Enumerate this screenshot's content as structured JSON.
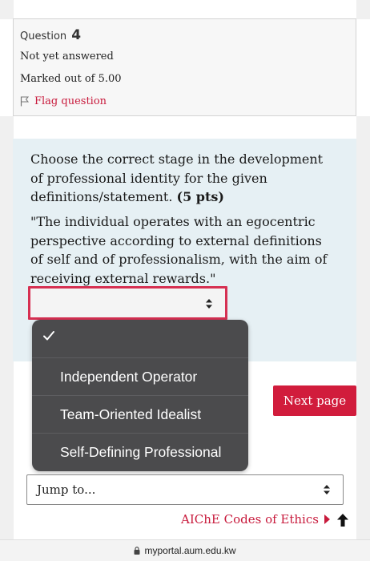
{
  "question": {
    "label": "Question",
    "number": "4",
    "state": "Not yet answered",
    "marks": "Marked out of 5.00",
    "flag_label": "Flag question"
  },
  "formulation": {
    "prompt": "Choose the correct stage in the development of professional identity for the given definitions/statement.",
    "points": "(5 pts)",
    "statement": "\"The individual operates with an egocentric perspective according to external definitions of self and of professionalism, with the aim of receiving external rewards.\""
  },
  "dropdown": {
    "selected": "",
    "options": [
      "",
      "Independent Operator",
      "Team-Oriented Idealist",
      "Self-Defining Professional"
    ]
  },
  "navigation": {
    "next_label": "Next page",
    "jump_label": "Jump to...",
    "prev_link": "AIChE Codes of Ethics"
  },
  "browser": {
    "url": "myportal.aum.edu.kw"
  },
  "colors": {
    "accent": "#d11c3c",
    "formulation_bg": "#e6f0f4",
    "dropdown_bg": "#4b4b4d"
  }
}
